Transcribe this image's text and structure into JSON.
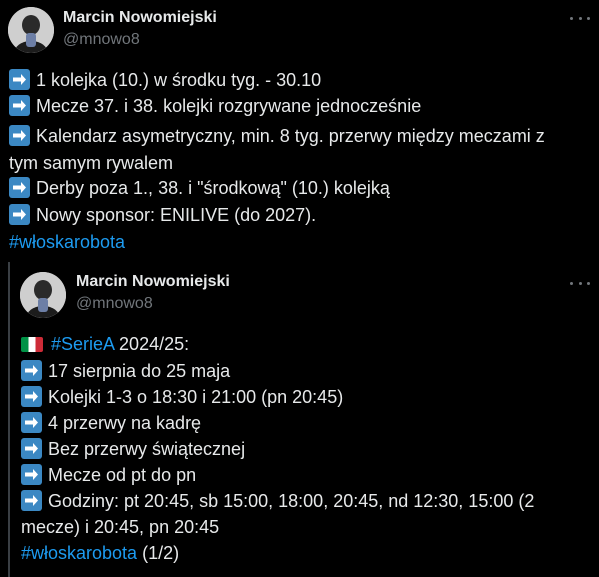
{
  "tweet1": {
    "author_name": "Marcin Nowomiejski",
    "author_handle": "@mnowo8",
    "lines": [
      "1 kolejka (10.) w środku tyg. - 30.10",
      "Mecze 37. i 38. kolejki rozgrywane jednocześnie",
      "Kalendarz asymetryczny, min. 8 tyg. przerwy między meczami z",
      "tym samym rywalem",
      "Derby poza 1., 38. i \"środkową\" (10.) kolejką",
      "Nowy sponsor: ENILIVE (do 2027)."
    ],
    "hashtag": "#włoskarobota"
  },
  "tweet2": {
    "author_name": "Marcin Nowomiejski",
    "author_handle": "@mnowo8",
    "header_hashtag": "#SerieA",
    "header_text": " 2024/25:",
    "lines": [
      "17 sierpnia do 25 maja",
      "Kolejki 1-3 o 18:30 i 21:00 (pn 20:45)",
      "4 przerwy na kadrę",
      "Bez przerwy świątecznej",
      "Mecze od pt do pn",
      "Godziny: pt 20:45, sb 15:00, 18:00, 20:45, nd 12:30, 15:00 (2",
      "mecze) i 20:45, pn 20:45"
    ],
    "hashtag": "#włoskarobota",
    "suffix": " (1/2)"
  },
  "icons": {
    "arrow": "right-arrow-emoji-icon",
    "flag": "italy-flag-icon",
    "more": "more-options-icon"
  },
  "colors": {
    "background": "#000000",
    "text": "#e7e9ea",
    "secondary": "#71767b",
    "link": "#1d9bf0",
    "arrow_emoji": "#3b88c3"
  }
}
